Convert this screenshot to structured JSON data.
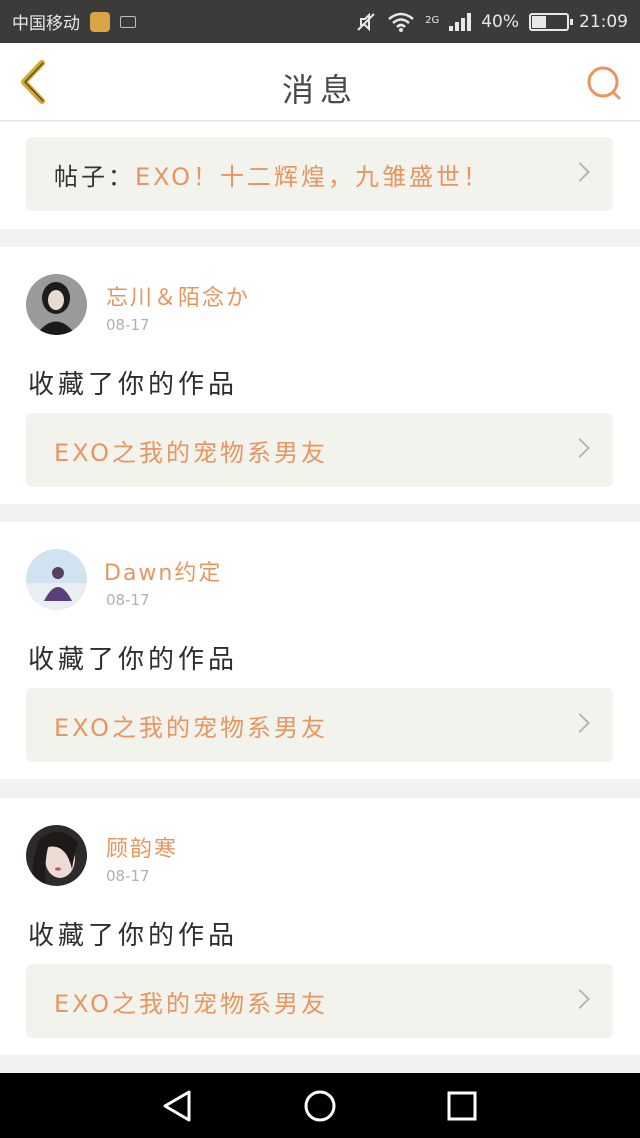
{
  "status_bar": {
    "carrier": "中国移动",
    "network": "2G",
    "battery": "40%",
    "battery_level": 0.4,
    "time": "21:09"
  },
  "header": {
    "title": "消息",
    "back_icon": "chevron-left-icon",
    "search_icon": "search-icon"
  },
  "colors": {
    "accent": "#e8955f",
    "back_icon": "#d4a62a",
    "card_link_bg": "#f3f3ee"
  },
  "post_card": {
    "prefix": "帖子：",
    "title": "EXO！十二辉煌，九雏盛世！"
  },
  "notifications": [
    {
      "username": "忘川＆陌念か",
      "date": "08-17",
      "action": "收藏了你的作品",
      "work_title": "EXO之我的宠物系男友"
    },
    {
      "username": "Dawn约定",
      "date": "08-17",
      "action": "收藏了你的作品",
      "work_title": "EXO之我的宠物系男友"
    },
    {
      "username": "顾韵寒",
      "date": "08-17",
      "action": "收藏了你的作品",
      "work_title": "EXO之我的宠物系男友"
    }
  ],
  "nav_bar": {
    "icons": [
      "back-triangle-icon",
      "home-circle-icon",
      "recents-square-icon"
    ]
  }
}
